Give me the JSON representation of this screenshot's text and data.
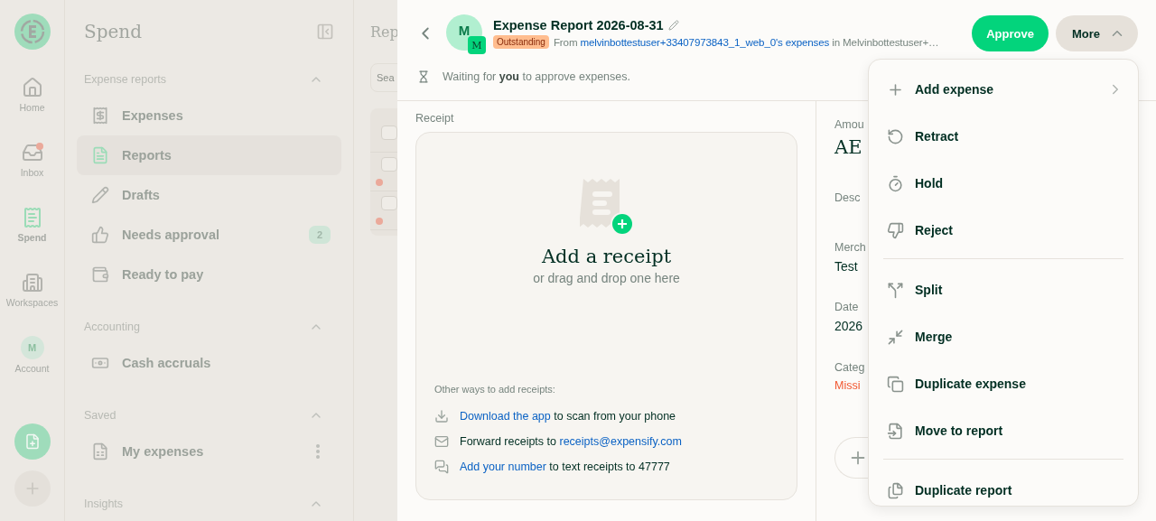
{
  "rail": {
    "items": [
      {
        "label": "Home",
        "selected": false,
        "has_notification": false
      },
      {
        "label": "Inbox",
        "selected": false,
        "has_notification": true
      },
      {
        "label": "Spend",
        "selected": true,
        "has_notification": false
      },
      {
        "label": "Workspaces",
        "selected": false,
        "has_notification": false
      },
      {
        "label": "Account",
        "avatar_letter": "M",
        "selected": false,
        "has_notification": false
      }
    ]
  },
  "sidebar": {
    "title": "Spend",
    "sections": [
      {
        "title": "Expense reports",
        "expanded": true,
        "items": [
          {
            "label": "Expenses",
            "selected": false
          },
          {
            "label": "Reports",
            "selected": true
          },
          {
            "label": "Drafts",
            "selected": false
          },
          {
            "label": "Needs approval",
            "selected": false,
            "badge": "2"
          },
          {
            "label": "Ready to pay",
            "selected": false
          }
        ]
      },
      {
        "title": "Accounting",
        "expanded": true,
        "items": [
          {
            "label": "Cash accruals",
            "selected": false
          }
        ]
      },
      {
        "title": "Saved",
        "expanded": true,
        "items": [
          {
            "label": "My expenses",
            "selected": false,
            "has_more": true
          }
        ]
      },
      {
        "title": "Insights",
        "expanded": true
      }
    ]
  },
  "list_pane": {
    "title": "Rep",
    "search": {
      "placeholder": "Sea"
    },
    "rows": [
      {
        "checked": false,
        "flagged": false
      },
      {
        "checked": false,
        "flagged": true
      },
      {
        "checked": false,
        "flagged": true
      }
    ]
  },
  "report": {
    "avatar_letter": "M",
    "workspace_letter": "M",
    "title": "Expense Report 2026-08-31",
    "status": "Outstanding",
    "source": {
      "prefix": "From",
      "link": "melvinbottestuser+33407973843_1_web_0's expenses",
      "suffix": "in Melvinbottestuser+…"
    },
    "actions": [
      {
        "label": "Approve",
        "kind": "primary"
      },
      {
        "label": "More",
        "kind": "menu",
        "expanded": true
      }
    ],
    "notice": "Waiting for **you** to approve expenses."
  },
  "receipt": {
    "label": "Receipt",
    "heading": "Add a receipt",
    "subheading": "or drag and drop one here",
    "other_title": "Other ways to add receipts:",
    "other_ways": [
      {
        "parts": [
          {
            "text": "Download the app",
            "link": true
          },
          {
            "text": " to scan from your phone",
            "link": false
          }
        ]
      },
      {
        "parts": [
          {
            "text": "Forward receipts to ",
            "link": false
          },
          {
            "text": "receipts@expensify.com",
            "link": true
          }
        ]
      },
      {
        "parts": [
          {
            "text": "Add your number",
            "link": true
          },
          {
            "text": " to text receipts to 47777",
            "link": false
          }
        ]
      }
    ]
  },
  "details": {
    "fields": [
      {
        "label": "Amou",
        "value": "AE",
        "kind": "amount"
      },
      {
        "label": "Desc",
        "kind": "empty"
      },
      {
        "label": "Merch",
        "value": "Test",
        "kind": "text"
      },
      {
        "label": "Date",
        "value": "2026",
        "kind": "text"
      },
      {
        "label": "Categ",
        "value": "Missi",
        "kind": "error"
      }
    ]
  },
  "menu": {
    "groups": [
      [
        {
          "label": "Add expense",
          "submenu": true
        },
        {
          "label": "Retract",
          "submenu": false
        },
        {
          "label": "Hold",
          "submenu": false
        },
        {
          "label": "Reject",
          "submenu": false
        }
      ],
      [
        {
          "label": "Split",
          "submenu": false
        },
        {
          "label": "Merge",
          "submenu": false
        },
        {
          "label": "Duplicate expense",
          "submenu": false
        },
        {
          "label": "Move to report",
          "submenu": false
        }
      ],
      [
        {
          "label": "Duplicate report",
          "submenu": false
        }
      ]
    ]
  }
}
